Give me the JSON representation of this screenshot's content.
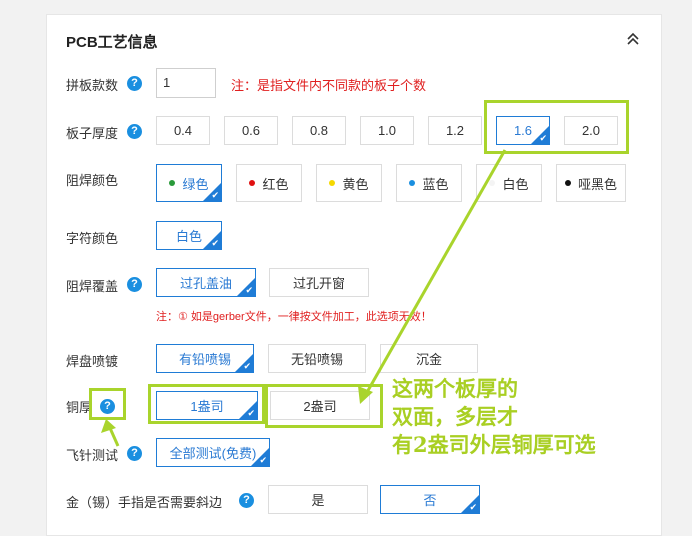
{
  "panel": {
    "title": "PCB工艺信息",
    "collapse_icon": "chevron-double-up-icon"
  },
  "rows": {
    "panels_count": {
      "label": "拼板款数",
      "value": "1",
      "note": "注：是指文件内不同款的板子个数"
    },
    "thickness": {
      "label": "板子厚度",
      "options": [
        "0.4",
        "0.6",
        "0.8",
        "1.0",
        "1.2",
        "1.6",
        "2.0"
      ],
      "selected": "1.6"
    },
    "mask_color": {
      "label": "阻焊颜色",
      "options": [
        {
          "label": "绿色",
          "color": "#2a9a3a"
        },
        {
          "label": "红色",
          "color": "#e01010"
        },
        {
          "label": "黄色",
          "color": "#f5d800"
        },
        {
          "label": "蓝色",
          "color": "#1a8fe0"
        },
        {
          "label": "白色",
          "color": "#f4f4f4"
        },
        {
          "label": "哑黑色",
          "color": "#111111"
        }
      ],
      "selected": "绿色"
    },
    "silk_color": {
      "label": "字符颜色",
      "options": [
        "白色"
      ],
      "selected": "白色"
    },
    "mask_cover": {
      "label": "阻焊覆盖",
      "options": [
        "过孔盖油",
        "过孔开窗"
      ],
      "selected": "过孔盖油",
      "note": "注：① 如是gerber文件，一律按文件加工，此选项无效！"
    },
    "pad_finish": {
      "label": "焊盘喷镀",
      "options": [
        "有铅喷锡",
        "无铅喷锡",
        "沉金"
      ],
      "selected": "有铅喷锡"
    },
    "copper": {
      "label": "铜厚",
      "options": [
        "1盎司",
        "2盎司"
      ],
      "selected": "1盎司"
    },
    "flying_probe": {
      "label": "飞针测试",
      "options": [
        "全部测试(免费)"
      ],
      "selected": "全部测试(免费)"
    },
    "gold_finger": {
      "label": "金（锡）手指是否需要斜边",
      "options": [
        "是",
        "否"
      ],
      "selected": "否"
    }
  },
  "help_icon_text": "?",
  "annotation": {
    "lines": [
      "这两个板厚的",
      "双面，多层才",
      "有2盎司外层铜厚可选"
    ],
    "color": "#a9d42c"
  }
}
